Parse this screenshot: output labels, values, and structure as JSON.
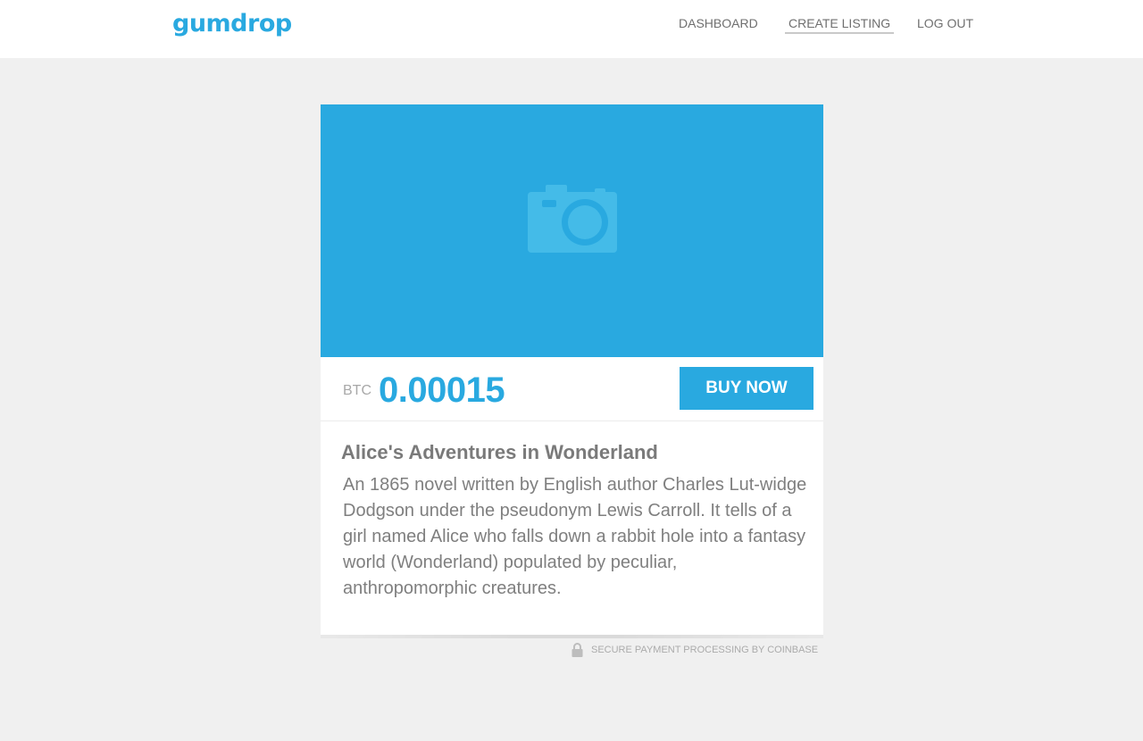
{
  "header": {
    "logo": "gumdrop",
    "nav": [
      {
        "label": "DASHBOARD"
      },
      {
        "label": "CREATE LISTING",
        "active": true
      },
      {
        "label": "LOG OUT"
      }
    ]
  },
  "listing": {
    "image_icon": "camera-icon",
    "currency": "BTC",
    "price": "0.00015",
    "buy_label": "BUY NOW",
    "title": "Alice's Adventures in Wonderland",
    "description": "An 1865 novel written by English author Charles Lut-widge Dodgson under the pseudonym Lewis Carroll. It tells of a girl named Alice who falls down a rabbit hole into a fantasy world (Wonderland) populated by peculiar, anthropomorphic creatures."
  },
  "footer": {
    "secure_icon": "lock-icon",
    "secure_text": "SECURE PAYMENT PROCESSING BY COINBASE"
  },
  "colors": {
    "accent": "#29a9e0",
    "background": "#f0f0f0",
    "text": "#7a7a7a"
  }
}
